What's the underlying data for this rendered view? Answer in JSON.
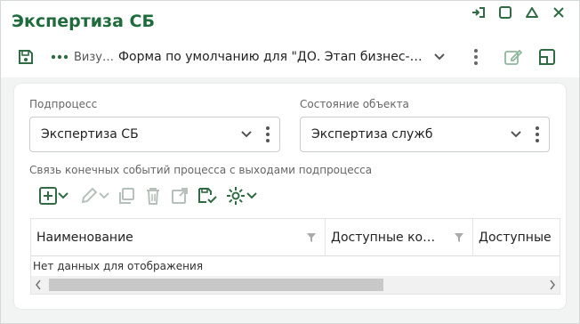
{
  "window": {
    "title": "Экспертиза СБ",
    "controls": [
      "pin-icon",
      "maximize-icon",
      "collapse-icon",
      "close-icon"
    ]
  },
  "toolbar": {
    "vis_label": "Визу…",
    "form_label": "Форма по умолчанию для \"ДО. Этап бизнес-…"
  },
  "fields": {
    "subprocess": {
      "label": "Подпроцесс",
      "value": "Экспертиза СБ"
    },
    "object_state": {
      "label": "Состояние объекта",
      "value": "Экспертиза служб"
    }
  },
  "grid": {
    "section_title": "Связь конечных событий процесса с выходами подпроцесса",
    "columns": [
      "Наименование",
      "Доступные ко…",
      "Доступные"
    ],
    "empty_message": "Нет данных для отображения"
  },
  "colors": {
    "accent": "#1f6b3c",
    "icon": "#2f6b43",
    "disabled_icon": "#b7c1bb"
  }
}
